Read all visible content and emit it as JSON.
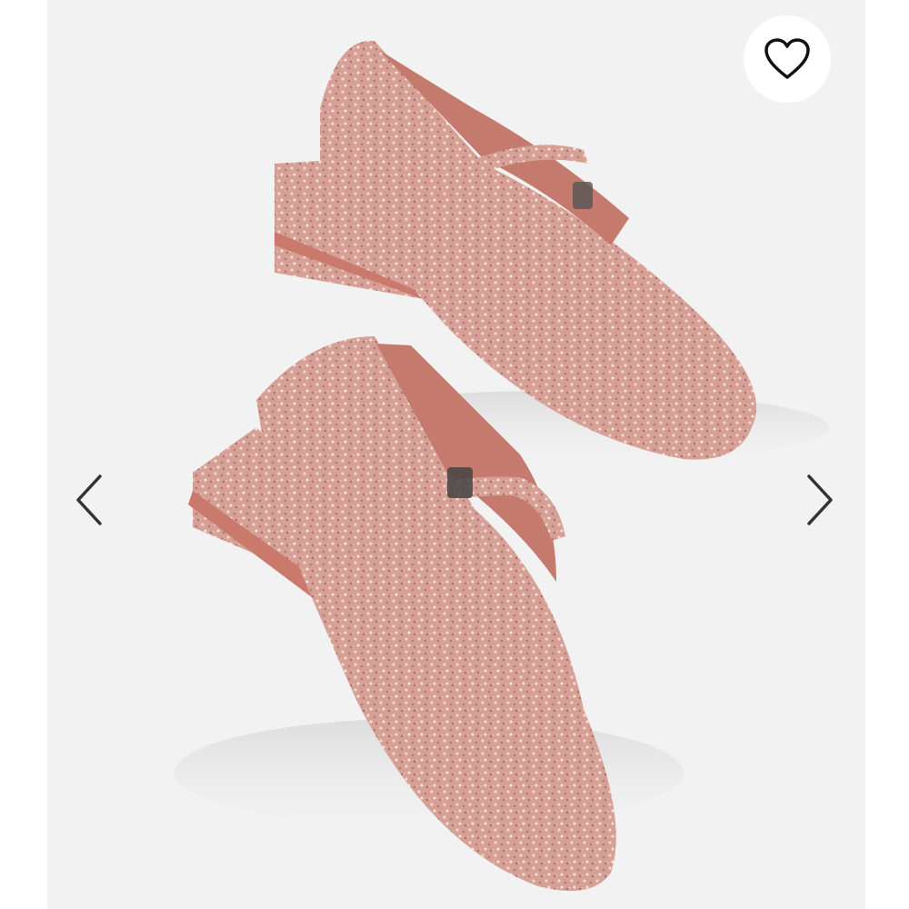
{
  "viewer": {
    "image_description_icon": "glitter-mary-jane-shoes-image",
    "prev_icon": "chevron-left-icon",
    "next_icon": "chevron-right-icon",
    "favorite_icon": "heart-outline-icon"
  },
  "colors": {
    "stage_background": "#f2f2f2",
    "glitter_pink": "#d9a39a",
    "lining_pink": "#c47a6c",
    "arrow_color": "#333333",
    "heart_color": "#111111"
  }
}
